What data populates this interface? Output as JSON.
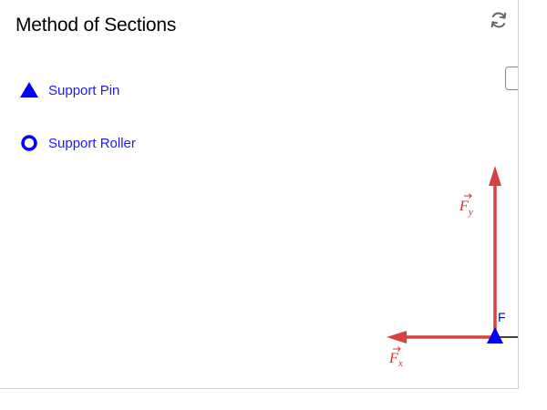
{
  "header": {
    "title": "Method of Sections"
  },
  "legend": {
    "items": [
      {
        "label": "Support Pin",
        "icon": "triangle-icon"
      },
      {
        "label": "Support Roller",
        "icon": "circle-icon"
      }
    ]
  },
  "diagram": {
    "point_label": "F",
    "force_x_symbol": "F",
    "force_x_subscript": "x",
    "force_y_symbol": "F",
    "force_y_subscript": "y"
  },
  "colors": {
    "accent": "#0000ff",
    "force_arrow": "#d94040",
    "force_text": "#cc3333",
    "member": "#444444"
  }
}
